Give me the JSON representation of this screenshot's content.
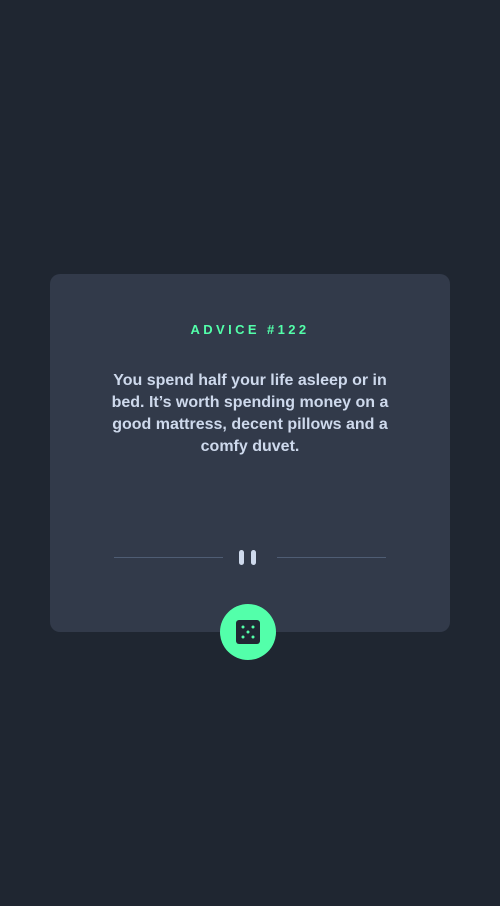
{
  "advice": {
    "id_label": "ADVICE #122",
    "text": "You spend half your life asleep or in bed. It’s worth spending money on a good mattress, decent pillows and a comfy duvet."
  },
  "controls": {
    "dice_icon": "dice-icon",
    "pause_icon": "pause-icon"
  },
  "colors": {
    "background": "#1f2631",
    "card": "#323a4a",
    "accent": "#53ffaa",
    "text": "#ced9ec",
    "divider": "#4f5d74"
  }
}
